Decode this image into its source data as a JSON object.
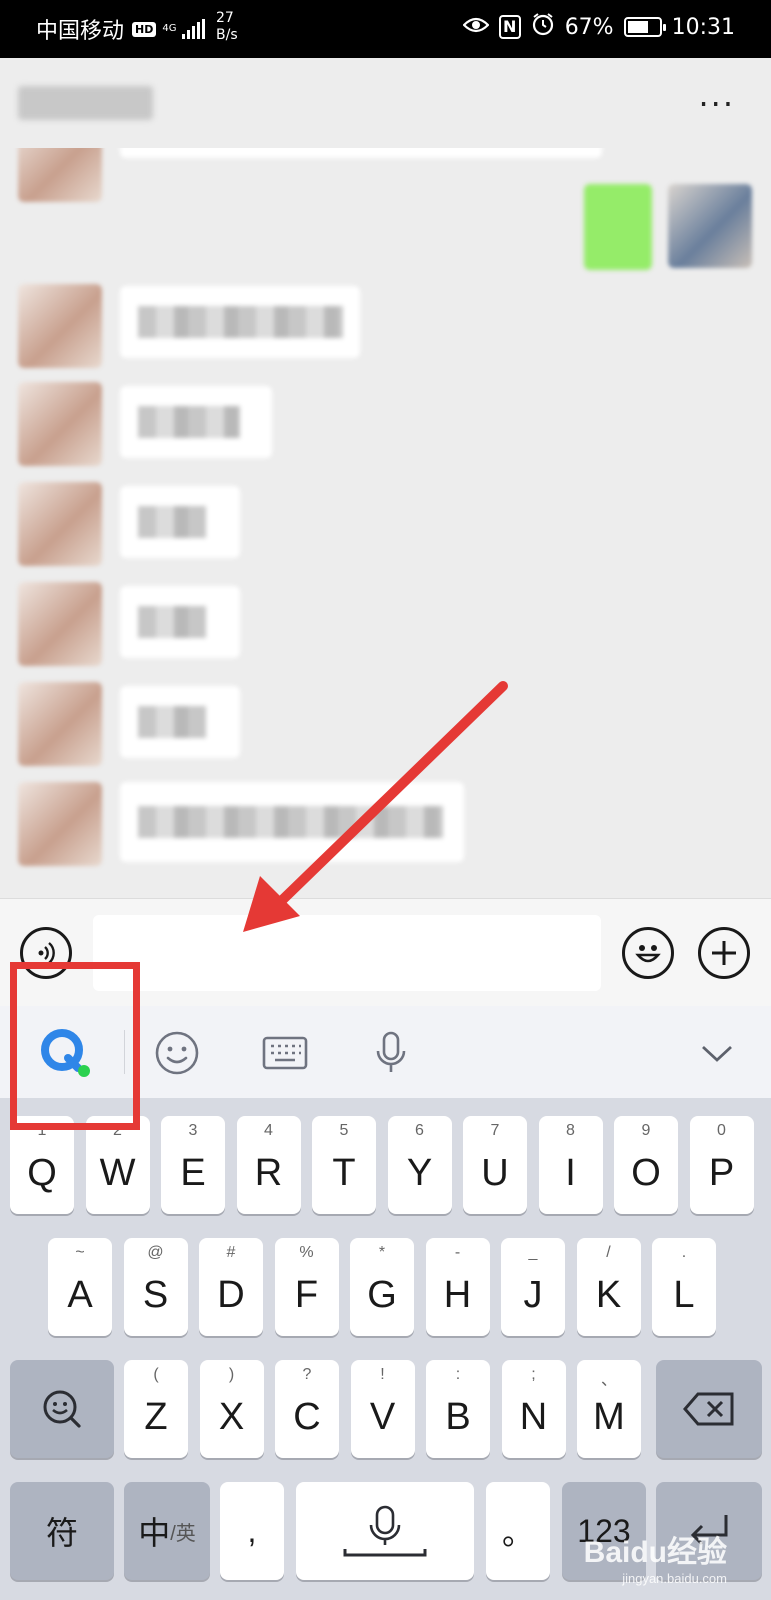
{
  "status_bar": {
    "carrier": "中国移动",
    "hd": "HD",
    "network": "4G",
    "speed_value": "27",
    "speed_unit": "B/s",
    "nfc": "N",
    "battery_percent": "67%",
    "battery_level": 0.67,
    "time": "10:31"
  },
  "header": {
    "more_label": "···"
  },
  "input_bar": {
    "message_value": "",
    "message_placeholder": ""
  },
  "keyboard": {
    "toolbar": [
      "ime-logo",
      "emoji",
      "keyboard-layout",
      "voice",
      "collapse"
    ],
    "row1": [
      {
        "letter": "Q",
        "sub": "1"
      },
      {
        "letter": "W",
        "sub": "2"
      },
      {
        "letter": "E",
        "sub": "3"
      },
      {
        "letter": "R",
        "sub": "4"
      },
      {
        "letter": "T",
        "sub": "5"
      },
      {
        "letter": "Y",
        "sub": "6"
      },
      {
        "letter": "U",
        "sub": "7"
      },
      {
        "letter": "I",
        "sub": "8"
      },
      {
        "letter": "O",
        "sub": "9"
      },
      {
        "letter": "P",
        "sub": "0"
      }
    ],
    "row2": [
      {
        "letter": "A",
        "sub": "~"
      },
      {
        "letter": "S",
        "sub": "@"
      },
      {
        "letter": "D",
        "sub": "#"
      },
      {
        "letter": "F",
        "sub": "%"
      },
      {
        "letter": "G",
        "sub": "*"
      },
      {
        "letter": "H",
        "sub": "-"
      },
      {
        "letter": "J",
        "sub": "_"
      },
      {
        "letter": "K",
        "sub": "/"
      },
      {
        "letter": "L",
        "sub": "."
      }
    ],
    "row3": [
      {
        "letter": "Z",
        "sub": "("
      },
      {
        "letter": "X",
        "sub": ")"
      },
      {
        "letter": "C",
        "sub": "?"
      },
      {
        "letter": "V",
        "sub": "!"
      },
      {
        "letter": "B",
        "sub": ":"
      },
      {
        "letter": "N",
        "sub": ";"
      },
      {
        "letter": "M",
        "sub": "、"
      }
    ],
    "symbol_key": "符",
    "lang_key_main": "中",
    "lang_key_alt": "/英",
    "comma_key": ",",
    "period_key": "。",
    "num_key": "123"
  },
  "watermark": {
    "brand": "Baidu经验",
    "site": "jingyan.baidu.com"
  },
  "colors": {
    "annotation_red": "#e53935",
    "ime_blue": "#2f86e8",
    "ime_green": "#2bd14f",
    "wechat_green": "#95ec69"
  }
}
